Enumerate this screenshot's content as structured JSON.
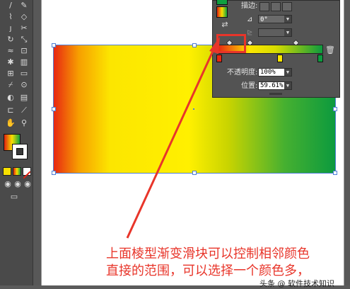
{
  "toolbar": {
    "tools": [
      "pen-tool-icon",
      "pencil-tool-icon",
      "brush-tool-icon",
      "eraser-tool-icon",
      "rotate-tool-icon",
      "scale-tool-icon",
      "warp-tool-icon",
      "free-transform-icon",
      "symbol-sprayer-icon",
      "column-graph-icon",
      "mesh-tool-icon",
      "gradient-tool-icon",
      "eyedropper-tool-icon",
      "blend-tool-icon",
      "slice-tool-icon",
      "scissors-tool-icon",
      "artboard-tool-icon",
      "hand-tool-icon",
      "zoom-tool-icon"
    ]
  },
  "gradient_panel": {
    "stroke_label": "描边:",
    "angle_value": "0°",
    "opacity_label": "不透明度:",
    "opacity_value": "100%",
    "location_label": "位置:",
    "location_value": "59.61%"
  },
  "annotation": {
    "line1": "上面棱型渐变滑块可以控制相邻颜色",
    "line2": "直接的范围，可以选择一个颜色多，"
  },
  "watermark": "头条 @ 软件技术知识",
  "colors": {
    "annotation_red": "#e8352a",
    "gradient_red": "#e82812",
    "gradient_yellow": "#fce600",
    "gradient_green": "#0c9a3e"
  }
}
